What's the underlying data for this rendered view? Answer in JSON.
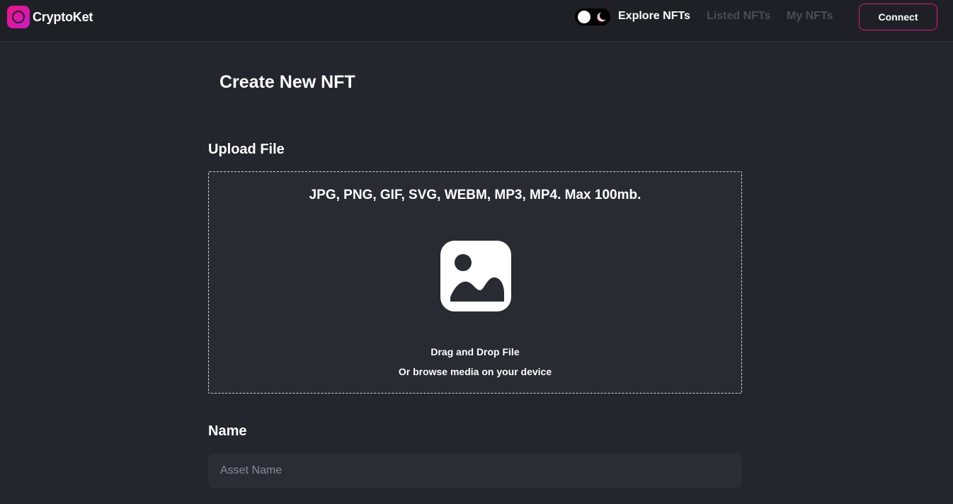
{
  "brand": {
    "name": "CryptoKet",
    "accent": "#eb1484"
  },
  "nav": {
    "links": [
      {
        "label": "Explore NFTs",
        "active": true
      },
      {
        "label": "Listed NFTs",
        "active": false
      },
      {
        "label": "My NFTs",
        "active": false
      }
    ],
    "connect_label": "Connect",
    "theme_toggle": {
      "state": "dark",
      "icon": "moon-icon"
    }
  },
  "page": {
    "title": "Create New NFT"
  },
  "upload": {
    "label": "Upload File",
    "formats": "JPG, PNG, GIF, SVG, WEBM, MP3, MP4. Max 100mb.",
    "icon": "image-icon",
    "drag_text": "Drag and Drop File",
    "browse_text": "Or browse media on your device"
  },
  "name_field": {
    "label": "Name",
    "placeholder": "Asset Name",
    "value": ""
  }
}
